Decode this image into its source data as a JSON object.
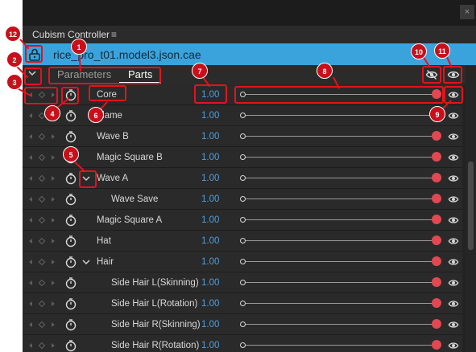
{
  "window": {
    "close_label": "×",
    "title": "Cubism Controller",
    "menu_icon": "≡"
  },
  "file": {
    "name": "rice_pro_t01.model3.json.cae",
    "icon": "lock-icon"
  },
  "tabs": [
    {
      "label": "Parameters",
      "active": false
    },
    {
      "label": "Parts",
      "active": true
    }
  ],
  "controls": {
    "collapse_icon": "chevron-down-icon",
    "hide_all_icon": "eye-off-icon",
    "show_all_icon": "eye-icon"
  },
  "rows": [
    {
      "label": "Core",
      "value": "1.00",
      "indent": 1,
      "expander": false
    },
    {
      "label": "Flame",
      "value": "1.00",
      "indent": 1,
      "expander": false
    },
    {
      "label": "Wave B",
      "value": "1.00",
      "indent": 1,
      "expander": false
    },
    {
      "label": "Magic Square B",
      "value": "1.00",
      "indent": 1,
      "expander": false
    },
    {
      "label": "Wave A",
      "value": "1.00",
      "indent": 1,
      "expander": true
    },
    {
      "label": "Wave Save",
      "value": "1.00",
      "indent": 2,
      "expander": false
    },
    {
      "label": "Magic Square A",
      "value": "1.00",
      "indent": 1,
      "expander": false
    },
    {
      "label": "Hat",
      "value": "1.00",
      "indent": 1,
      "expander": false
    },
    {
      "label": "Hair",
      "value": "1.00",
      "indent": 1,
      "expander": true
    },
    {
      "label": "Side Hair L(Skinning)",
      "value": "1.00",
      "indent": 2,
      "expander": false
    },
    {
      "label": "Side Hair L(Rotation)",
      "value": "1.00",
      "indent": 2,
      "expander": false
    },
    {
      "label": "Side Hair R(Skinning)",
      "value": "1.00",
      "indent": 2,
      "expander": false
    },
    {
      "label": "Side Hair R(Rotation)",
      "value": "1.00",
      "indent": 2,
      "expander": false
    }
  ],
  "slider_level": 1.0,
  "callouts": [
    "1",
    "2",
    "3",
    "4",
    "5",
    "6",
    "7",
    "8",
    "9",
    "10",
    "11",
    "12"
  ],
  "colors": {
    "accent": "#3aa3dc",
    "value_text": "#4d9fe0",
    "slider_knob": "#e14852",
    "annotation": "#e0141e"
  }
}
